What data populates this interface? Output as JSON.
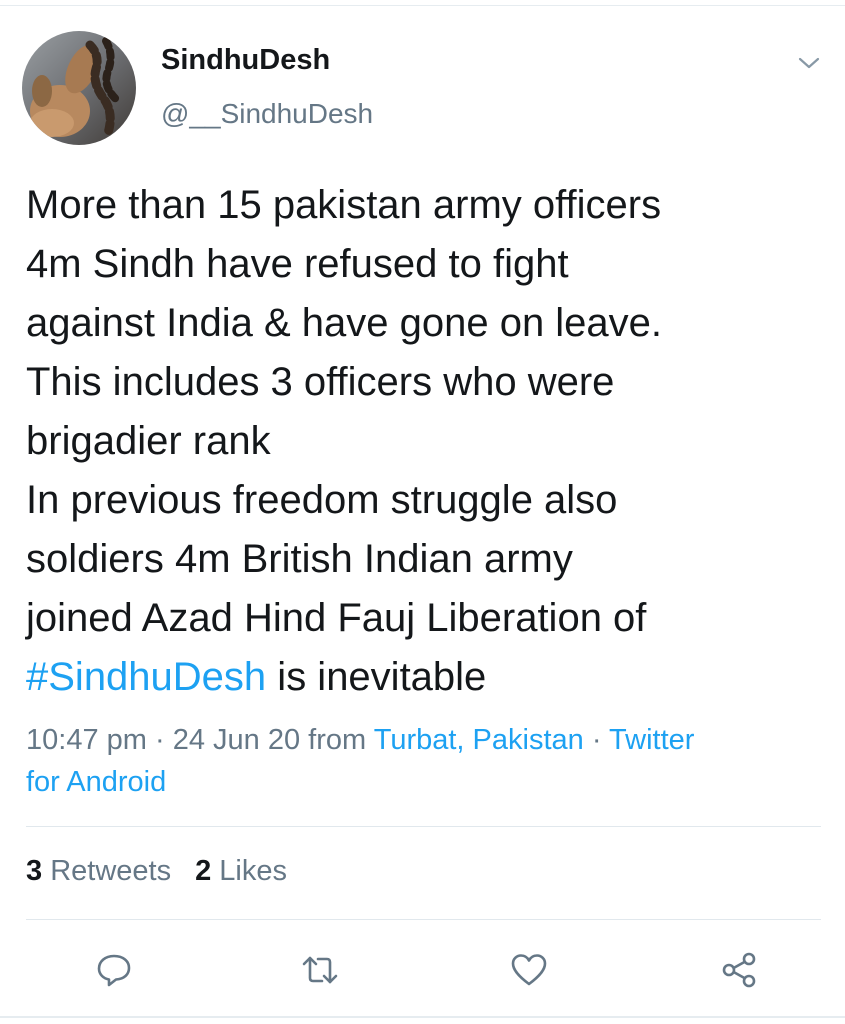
{
  "tweet": {
    "author": {
      "display_name": "SindhuDesh",
      "handle": "@__SindhuDesh",
      "avatar_icon": "avatar-photo"
    },
    "menu_icon": "chevron-down-icon",
    "text_lines": [
      "More than 15 pakistan army officers",
      "4m Sindh have refused to fight",
      "against India & have gone on leave.",
      "This includes 3 officers who were",
      "brigadier rank",
      "In previous freedom struggle also",
      "soldiers 4m British Indian army",
      "joined Azad Hind Fauj Liberation of"
    ],
    "last_line": {
      "hashtag": "#SindhuDesh",
      "rest": " is inevitable"
    },
    "meta": {
      "time": "10:47 pm",
      "sep1": " · ",
      "date": "24 Jun 20",
      "from": " from ",
      "location": "Turbat, Pakistan",
      "sep2": " · ",
      "client_part1": "Twitter",
      "client_part2": "for Android"
    },
    "stats": {
      "retweets_count": "3",
      "retweets_label": " Retweets",
      "likes_count": "2",
      "likes_label": " Likes"
    },
    "actions": [
      {
        "name": "reply",
        "icon": "reply-icon"
      },
      {
        "name": "retweet",
        "icon": "retweet-icon"
      },
      {
        "name": "like",
        "icon": "heart-icon"
      },
      {
        "name": "share",
        "icon": "share-icon"
      }
    ]
  },
  "colors": {
    "text": "#14171a",
    "secondary": "#657786",
    "link": "#1da1f2",
    "divider": "#e1e8ed"
  }
}
